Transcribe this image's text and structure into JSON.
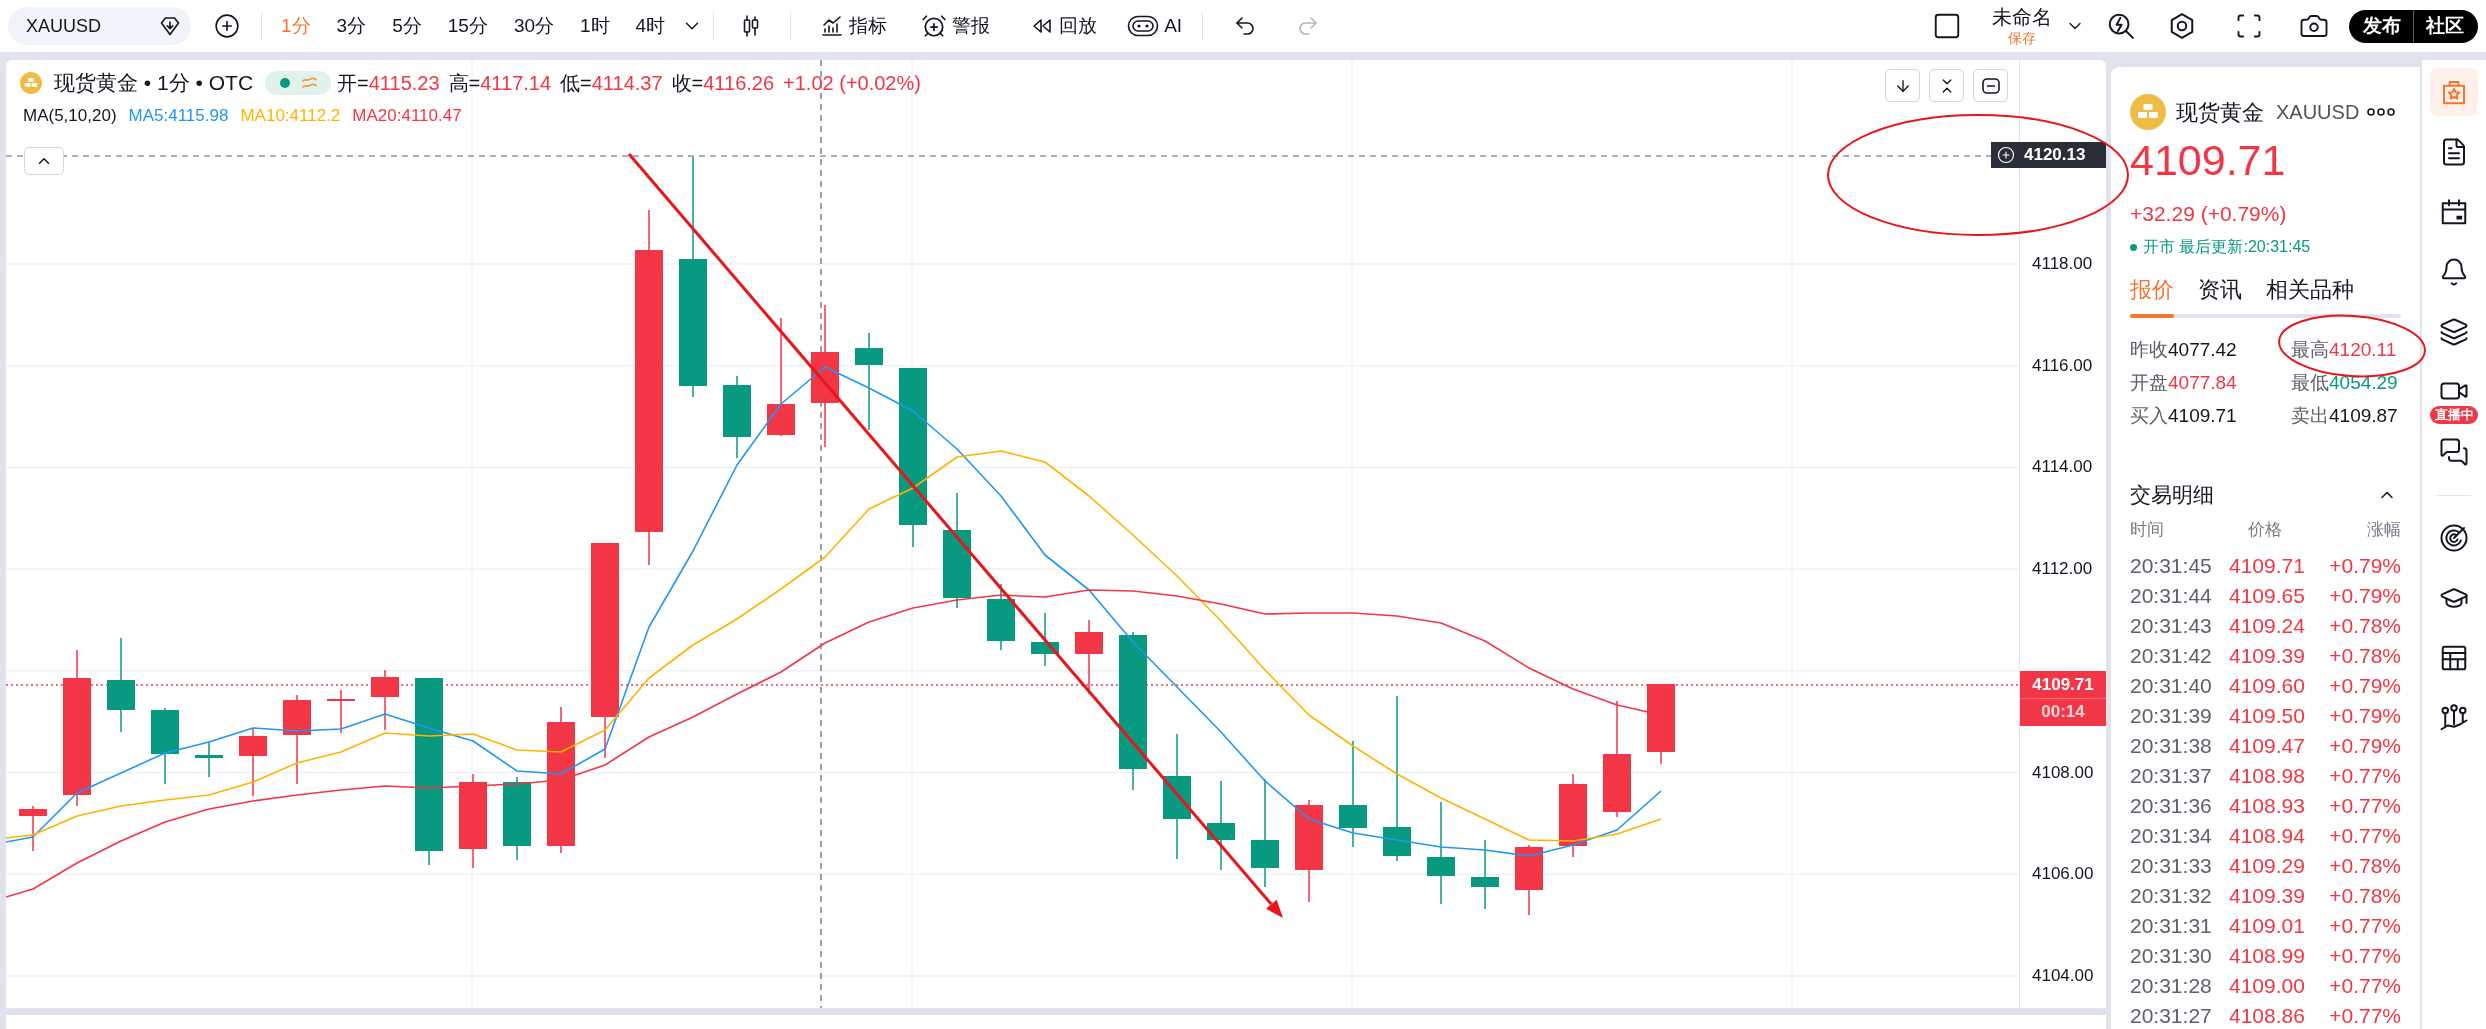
{
  "toolbar": {
    "symbol_search": {
      "value": "XAUUSD"
    },
    "intervals": [
      {
        "label": "1分",
        "selected": true
      },
      {
        "label": "3分",
        "selected": false
      },
      {
        "label": "5分",
        "selected": false
      },
      {
        "label": "15分",
        "selected": false
      },
      {
        "label": "30分",
        "selected": false
      },
      {
        "label": "1时",
        "selected": false
      },
      {
        "label": "4时",
        "selected": false
      }
    ],
    "tools": [
      {
        "label": "指标"
      },
      {
        "label": "警报"
      },
      {
        "label": "回放"
      },
      {
        "label": "AI"
      }
    ],
    "history": [
      {
        "disabled": false
      },
      {
        "disabled": true
      }
    ],
    "layout": {
      "name": "未命名",
      "save": "保存"
    },
    "actions": [
      "发布",
      "社区"
    ]
  },
  "chart": {
    "legend": {
      "title": "现货黄金 • 1分 • OTC",
      "market_open": true,
      "ohlc": [
        {
          "label": "开=",
          "value": "4115.23"
        },
        {
          "label": "高=",
          "value": "4117.14"
        },
        {
          "label": "低=",
          "value": "4114.37"
        },
        {
          "label": "收=",
          "value": "4116.26"
        }
      ],
      "change": "+1.02 (+0.02%)"
    },
    "indicator": {
      "label": "MA(5,10,20)",
      "lines": [
        {
          "label": "MA5:4115.98",
          "color": "#2196f3"
        },
        {
          "label": "MA10:4112.2",
          "color": "#ffb300"
        },
        {
          "label": "MA20:4110.47",
          "color": "#f23645"
        }
      ]
    },
    "price_axis": {
      "ticks_above_price": [
        "4118.00",
        "4116.00",
        "4114.00",
        "4112.00"
      ],
      "ticks_below_price": [
        "4108.00",
        "4106.00",
        "4104.00"
      ],
      "crosshair_price": "4120.13",
      "last_price": "4109.71",
      "countdown": "00:14"
    }
  },
  "quote_panel": {
    "name": "现货黄金",
    "symbol": "XAUUSD",
    "price": "4109.71",
    "change": "+32.29 (+0.79%)",
    "status": {
      "open": true,
      "text": "开市 最后更新:20:31:45"
    },
    "tabs": [
      {
        "label": "报价",
        "selected": true
      },
      {
        "label": "资讯",
        "selected": false
      },
      {
        "label": "相关品种",
        "selected": false
      }
    ],
    "stats": [
      {
        "label": "昨收",
        "value": "4077.42",
        "color": "#131722"
      },
      {
        "label": "最高",
        "value": "4120.11",
        "color": "#f23645"
      },
      {
        "label": "开盘",
        "value": "4077.84",
        "color": "#f23645"
      },
      {
        "label": "最低",
        "value": "4054.29",
        "color": "#089981"
      },
      {
        "label": "买入",
        "value": "4109.71",
        "color": "#131722"
      },
      {
        "label": "卖出",
        "value": "4109.87",
        "color": "#131722"
      }
    ],
    "trades": {
      "title": "交易明细",
      "expanded": true,
      "columns": [
        "时间",
        "价格",
        "涨幅"
      ],
      "rows": [
        {
          "time": "20:31:45",
          "price": "4109.71",
          "change": "+0.79%"
        },
        {
          "time": "20:31:44",
          "price": "4109.65",
          "change": "+0.79%"
        },
        {
          "time": "20:31:43",
          "price": "4109.24",
          "change": "+0.78%"
        },
        {
          "time": "20:31:42",
          "price": "4109.39",
          "change": "+0.78%"
        },
        {
          "time": "20:31:40",
          "price": "4109.60",
          "change": "+0.79%"
        },
        {
          "time": "20:31:39",
          "price": "4109.50",
          "change": "+0.79%"
        },
        {
          "time": "20:31:38",
          "price": "4109.47",
          "change": "+0.79%"
        },
        {
          "time": "20:31:37",
          "price": "4108.98",
          "change": "+0.77%"
        },
        {
          "time": "20:31:36",
          "price": "4108.93",
          "change": "+0.77%"
        },
        {
          "time": "20:31:34",
          "price": "4108.94",
          "change": "+0.77%"
        },
        {
          "time": "20:31:33",
          "price": "4109.29",
          "change": "+0.78%"
        },
        {
          "time": "20:31:32",
          "price": "4109.39",
          "change": "+0.78%"
        },
        {
          "time": "20:31:31",
          "price": "4109.01",
          "change": "+0.77%"
        },
        {
          "time": "20:31:30",
          "price": "4108.99",
          "change": "+0.77%"
        },
        {
          "time": "20:31:28",
          "price": "4109.00",
          "change": "+0.77%"
        },
        {
          "time": "20:31:27",
          "price": "4108.86",
          "change": "+0.77%"
        }
      ]
    }
  },
  "side_toolbar": {
    "items": [
      {
        "selected": true
      },
      {
        "selected": false
      },
      {
        "selected": false
      },
      {
        "selected": false
      },
      {
        "selected": false
      },
      {
        "selected": false,
        "badge": "直播中"
      },
      {
        "selected": false
      },
      {
        "selected": false
      },
      {
        "selected": false
      },
      {
        "selected": false
      },
      {
        "selected": false
      }
    ]
  }
}
